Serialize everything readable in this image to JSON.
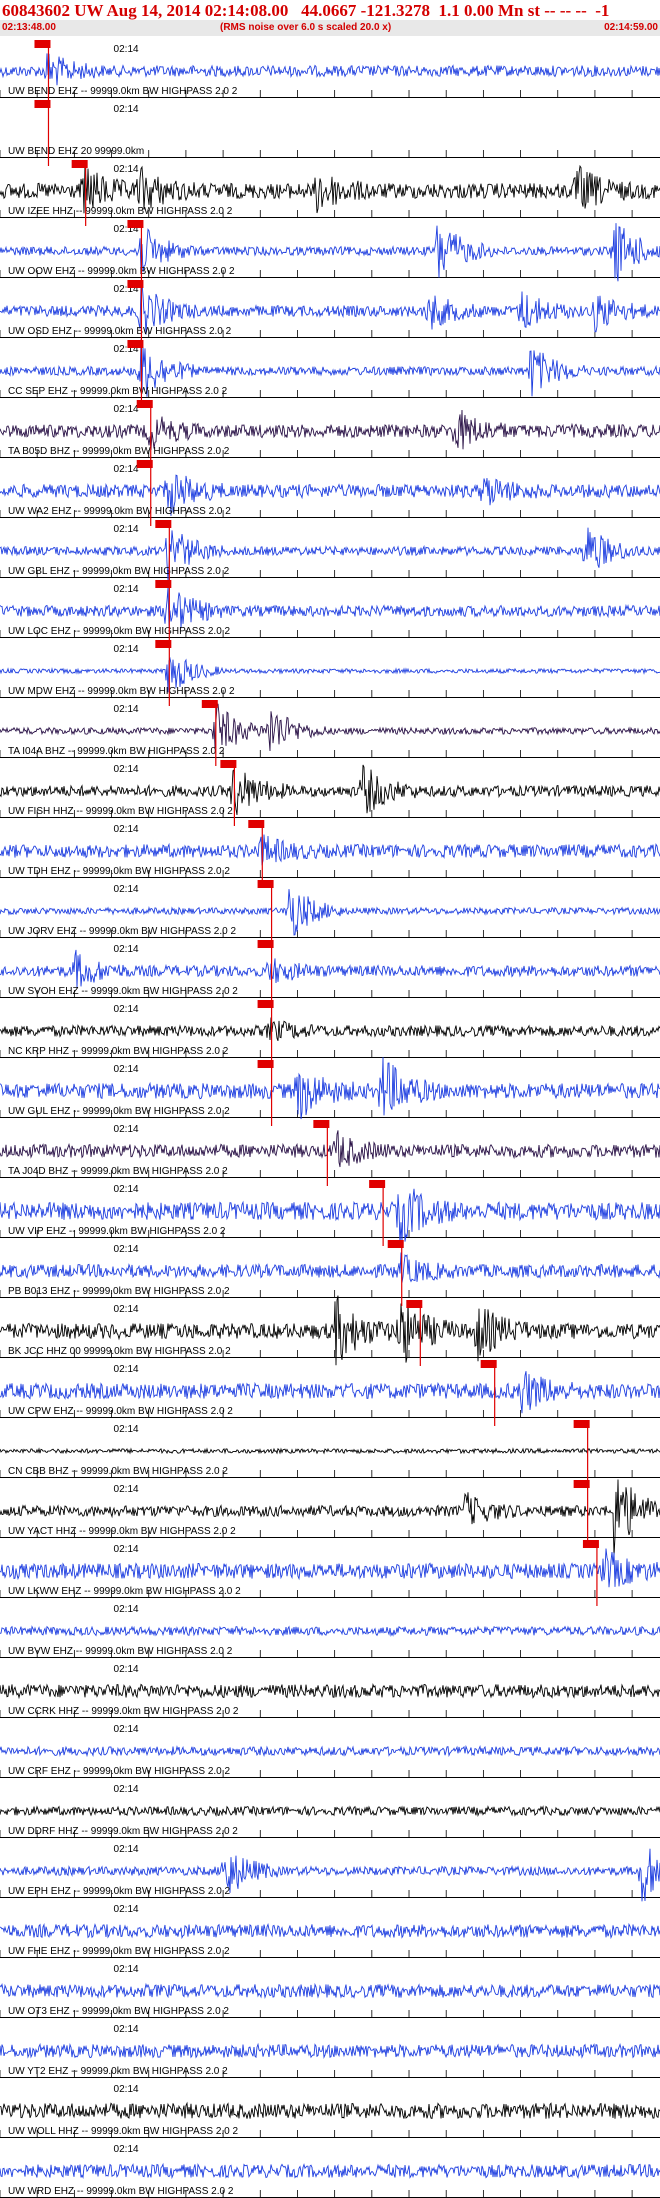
{
  "header": {
    "title": "60843602 UW Aug 14, 2014 02:14:08.00   44.0667 -121.3278  1.1 0.00 Mn st -- -- --  -1",
    "start_time": "02:13:48.00",
    "noise_note": "(RMS noise over 6.0 s scaled 20.0 x)",
    "end_time": "02:14:59.00"
  },
  "colors": {
    "blue": "#1f3fe0",
    "black": "#000000",
    "purple": "#2a1247",
    "red": "#e00000",
    "grid": "#000000"
  },
  "chart_data": {
    "type": "line",
    "x_range_seconds": [
      0,
      71
    ],
    "time_tick_label": "02:14",
    "traces": [
      {
        "label": "UW BEND EHZ -- 99999.0km BW  HIGHPASS  2.0  2",
        "color": "blue",
        "pick": "P",
        "amp": 0.25,
        "events": [
          {
            "t": 5,
            "a": 0.8
          }
        ]
      },
      {
        "label": "UW BEND EHZ 20 99999.0km",
        "color": "blue",
        "pick": "P",
        "amp": 0,
        "events": []
      },
      {
        "label": "UW IZEE HHZ -- 99999.0km BW  HIGHPASS  2.0  2",
        "color": "black",
        "pick": "P",
        "amp": 0.35,
        "events": [
          {
            "t": 9,
            "a": 1
          },
          {
            "t": 15,
            "a": 0.9
          },
          {
            "t": 34,
            "a": 0.9
          },
          {
            "t": 62,
            "a": 1
          }
        ]
      },
      {
        "label": "UW OOW EHZ -- 99999.0km BW  HIGHPASS  2.0  2",
        "color": "blue",
        "pick": "P",
        "amp": 0.2,
        "events": [
          {
            "t": 15,
            "a": 1.2
          },
          {
            "t": 47,
            "a": 1.5
          },
          {
            "t": 66,
            "a": 1.5
          }
        ]
      },
      {
        "label": "UW OSD EHZ -- 99999.0km BW  HIGHPASS  2.0  2",
        "color": "blue",
        "pick": "P",
        "amp": 0.25,
        "events": [
          {
            "t": 15,
            "a": 1.2
          },
          {
            "t": 46,
            "a": 0.8
          },
          {
            "t": 56,
            "a": 0.9
          },
          {
            "t": 64,
            "a": 0.8
          }
        ]
      },
      {
        "label": "CC SEP EHZ -- 99999.0km BW  HIGHPASS  2.0  2",
        "color": "blue",
        "pick": "P",
        "amp": 0.2,
        "events": [
          {
            "t": 15,
            "a": 1.5
          },
          {
            "t": 57,
            "a": 1.2
          }
        ]
      },
      {
        "label": "TA B05D BHZ -- 99999.0km BW  HIGHPASS  2.0  2",
        "color": "purple",
        "pick": "P",
        "amp": 0.3,
        "events": [
          {
            "t": 16,
            "a": 0.7
          },
          {
            "t": 49,
            "a": 0.9
          }
        ]
      },
      {
        "label": "UW WA2 EHZ -- 99999.0km BW  HIGHPASS  2.0  2",
        "color": "blue",
        "pick": "P",
        "amp": 0.3,
        "events": [
          {
            "t": 18,
            "a": 1
          },
          {
            "t": 52,
            "a": 0.6
          }
        ]
      },
      {
        "label": "UW GBL EHZ -- 99999.0km BW  HIGHPASS  2.0  2",
        "color": "blue",
        "pick": "P",
        "amp": 0.2,
        "events": [
          {
            "t": 18,
            "a": 1.3
          },
          {
            "t": 63,
            "a": 1.2
          }
        ]
      },
      {
        "label": "UW LOC EHZ -- 99999.0km BW  HIGHPASS  2.0  2",
        "color": "blue",
        "pick": "P",
        "amp": 0.25,
        "events": [
          {
            "t": 18,
            "a": 1.2
          }
        ]
      },
      {
        "label": "UW MDW EHZ -- 99999.0km BW  HIGHPASS  2.0  2",
        "color": "blue",
        "pick": "P",
        "amp": 0.1,
        "events": [
          {
            "t": 18,
            "a": 1.2
          }
        ]
      },
      {
        "label": "TA I04A BHZ -- 99999.0km BW  HIGHPASS  2.0  2",
        "color": "purple",
        "pick": "P",
        "amp": 0.15,
        "events": [
          {
            "t": 23,
            "a": 1.4
          },
          {
            "t": 29,
            "a": 1.2
          }
        ]
      },
      {
        "label": "UW FISH HHZ -- 99999.0km BW  HIGHPASS  2.0  2",
        "color": "black",
        "pick": "P",
        "amp": 0.25,
        "events": [
          {
            "t": 25,
            "a": 1.2
          },
          {
            "t": 39,
            "a": 1.1
          }
        ]
      },
      {
        "label": "UW TDH EHZ -- 99999.0km BW  HIGHPASS  2.0  2",
        "color": "blue",
        "pick": "P",
        "amp": 0.3,
        "events": [
          {
            "t": 28,
            "a": 0.6
          }
        ]
      },
      {
        "label": "UW JORV EHZ -- 99999.0km BW  HIGHPASS  2.0  2",
        "color": "blue",
        "pick": "P",
        "amp": 0.15,
        "events": [
          {
            "t": 31,
            "a": 1.4
          }
        ]
      },
      {
        "label": "UW SVOH EHZ -- 99999.0km BW  HIGHPASS  2.0  2",
        "color": "blue",
        "pick": "P",
        "amp": 0.25,
        "events": [
          {
            "t": 8,
            "a": 0.8
          },
          {
            "t": 29,
            "a": 0.5
          }
        ]
      },
      {
        "label": "NC KRP HHZ -- 99999.0km BW  HIGHPASS  2.0  2",
        "color": "black",
        "pick": "P",
        "amp": 0.25,
        "events": [
          {
            "t": 29,
            "a": 0.4
          }
        ]
      },
      {
        "label": "UW GUL EHZ -- 99999.0km BW  HIGHPASS  2.0  2",
        "color": "blue",
        "pick": "P",
        "amp": 0.35,
        "events": [
          {
            "t": 32,
            "a": 1.2
          },
          {
            "t": 41,
            "a": 1.5
          }
        ]
      },
      {
        "label": "TA J04D BHZ -- 99999.0km BW  HIGHPASS  2.0  2",
        "color": "purple",
        "pick": "P",
        "amp": 0.3,
        "events": [
          {
            "t": 36,
            "a": 0.8
          }
        ]
      },
      {
        "label": "UW VIP EHZ -- 99999.0km BW  HIGHPASS  2.0  2",
        "color": "blue",
        "pick": "P",
        "amp": 0.4,
        "events": [
          {
            "t": 43,
            "a": 1.3
          }
        ]
      },
      {
        "label": "PB B013 EHZ -- 99999.0km BW  HIGHPASS  2.0  2",
        "color": "blue",
        "pick": "P",
        "amp": 0.3,
        "events": [
          {
            "t": 43,
            "a": 0.6
          }
        ]
      },
      {
        "label": "BK JCC HHZ 00 99999.0km BW  HIGHPASS  2.0  2",
        "color": "black",
        "pick": "P",
        "amp": 0.35,
        "events": [
          {
            "t": 36,
            "a": 1.5
          },
          {
            "t": 43,
            "a": 1.6
          },
          {
            "t": 51,
            "a": 1.3
          }
        ]
      },
      {
        "label": "UW CPW EHZ -- 99999.0km BW  HIGHPASS  2.0  2",
        "color": "blue",
        "pick": "P",
        "amp": 0.35,
        "events": [
          {
            "t": 56,
            "a": 0.9
          }
        ]
      },
      {
        "label": "CN CBB BHZ -- 99999.0km BW  HIGHPASS  2.0  2",
        "color": "black",
        "pick": "P",
        "amp": 0.1,
        "events": []
      },
      {
        "label": "UW YACT HHZ -- 99999.0km BW  HIGHPASS  2.0  2",
        "color": "black",
        "pick": "P",
        "amp": 0.25,
        "events": [
          {
            "t": 50,
            "a": 0.7
          },
          {
            "t": 66,
            "a": 2
          }
        ]
      },
      {
        "label": "UW LKWW EHZ -- 99999.0km BW  HIGHPASS  2.0  2",
        "color": "blue",
        "pick": "P",
        "amp": 0.35,
        "events": [
          {
            "t": 65,
            "a": 0.8
          }
        ]
      },
      {
        "label": "UW BVW EHZ -- 99999.0km BW  HIGHPASS  2.0  2",
        "color": "blue",
        "pick": "",
        "amp": 0.2,
        "events": []
      },
      {
        "label": "UW CCRK HHZ -- 99999.0km BW  HIGHPASS  2.0  2",
        "color": "black",
        "pick": "",
        "amp": 0.3,
        "events": []
      },
      {
        "label": "UW CRF EHZ -- 99999.0km BW  HIGHPASS  2.0  2",
        "color": "blue",
        "pick": "",
        "amp": 0.2,
        "events": []
      },
      {
        "label": "UW DDRF HHZ -- 99999.0km BW  HIGHPASS  2.0  2",
        "color": "black",
        "pick": "",
        "amp": 0.2,
        "events": []
      },
      {
        "label": "UW EPH EHZ -- 99999.0km BW  HIGHPASS  2.0  2",
        "color": "blue",
        "pick": "",
        "amp": 0.2,
        "events": [
          {
            "t": 24,
            "a": 1.3
          },
          {
            "t": 69,
            "a": 1.5
          }
        ]
      },
      {
        "label": "UW FHE EHZ -- 99999.0km BW  HIGHPASS  2.0  2",
        "color": "blue",
        "pick": "",
        "amp": 0.3,
        "events": []
      },
      {
        "label": "UW OT3 EHZ -- 99999.0km BW  HIGHPASS  2.0  2",
        "color": "blue",
        "pick": "",
        "amp": 0.3,
        "events": []
      },
      {
        "label": "UW YT2 EHZ -- 99999.0km BW  HIGHPASS  2.0  2",
        "color": "blue",
        "pick": "",
        "amp": 0.3,
        "events": []
      },
      {
        "label": "UW WOLL HHZ -- 99999.0km BW  HIGHPASS  2.0  2",
        "color": "black",
        "pick": "",
        "amp": 0.35,
        "events": []
      },
      {
        "label": "UW WRD EHZ -- 99999.0km BW  HIGHPASS  2.0  2",
        "color": "blue",
        "pick": "",
        "amp": 0.3,
        "events": []
      }
    ],
    "picks_seconds": [
      5,
      5,
      9,
      15,
      15,
      15,
      16,
      16,
      18,
      18,
      18,
      23,
      25,
      28,
      29,
      29,
      29,
      29,
      35,
      41,
      43,
      45,
      53,
      63,
      63,
      64
    ]
  }
}
